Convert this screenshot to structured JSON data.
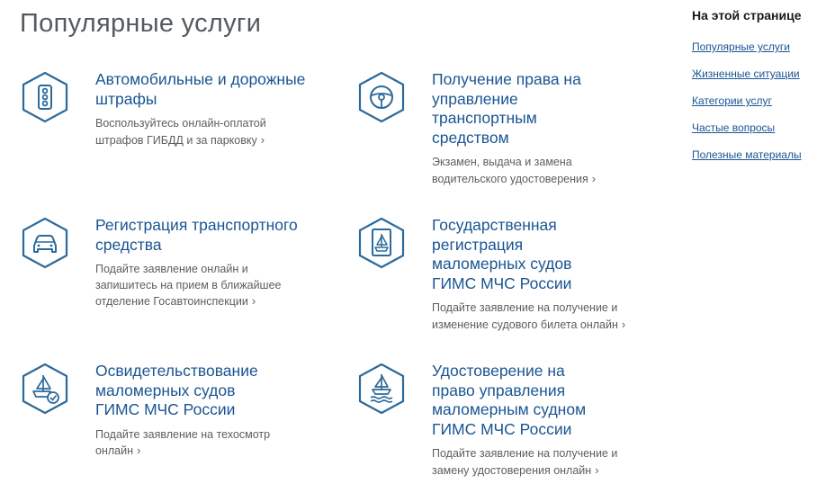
{
  "page_title": "Популярные услуги",
  "sidebar": {
    "title": "На этой странице",
    "links": [
      "Популярные услуги",
      "Жизненные ситуации",
      "Категории услуг",
      "Частые вопросы",
      "Полезные материалы"
    ]
  },
  "services": [
    {
      "icon": "traffic-light-icon",
      "title": "Автомобильные и дорожные штрафы",
      "description": "Воспользуйтесь онлайн-оплатой штрафов ГИБДД и за парковку"
    },
    {
      "icon": "steering-wheel-icon",
      "title": "Получение права на управление транспортным средством",
      "description": "Экзамен, выдача и замена водительского удостоверения"
    },
    {
      "icon": "car-icon",
      "title": "Регистрация транспортного средства",
      "description": "Подайте заявление онлайн и запишитесь на прием в ближайшее отделение Госавтоинспекции"
    },
    {
      "icon": "boat-document-icon",
      "title": "Государственная регистрация маломерных судов ГИМС МЧС России",
      "description": "Подайте заявление на получение и изменение судового билета онлайн"
    },
    {
      "icon": "boat-check-icon",
      "title": "Освидетельствование маломерных судов ГИМС МЧС России",
      "description": "Подайте заявление на техосмотр онлайн"
    },
    {
      "icon": "boat-waves-icon",
      "title": "Удостоверение на право управления маломерным судном ГИМС МЧС России",
      "description": "Подайте заявление на получение и замену удостоверения онлайн"
    }
  ],
  "colors": {
    "accent": "#1a5593",
    "icon_stroke": "#2b6a9c",
    "text_muted": "#5a5e63"
  }
}
